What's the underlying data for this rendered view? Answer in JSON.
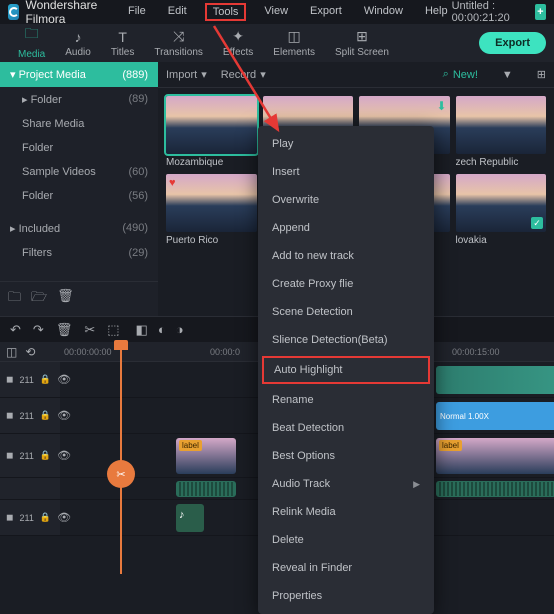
{
  "app": {
    "name": "Wondershare Filmora",
    "doc_title": "Untitled : 00:00:21:20"
  },
  "menu": {
    "file": "File",
    "edit": "Edit",
    "tools": "Tools",
    "view": "View",
    "export": "Export",
    "window": "Window",
    "help": "Help"
  },
  "tabs": {
    "media": "Media",
    "audio": "Audio",
    "titles": "Titles",
    "transitions": "Transitions",
    "effects": "Effects",
    "elements": "Elements",
    "split": "Split Screen"
  },
  "export_button": "Export",
  "sidebar": {
    "header": {
      "label": "Project Media",
      "count": "(889)"
    },
    "items": [
      {
        "label": "▸ Folder",
        "count": "(89)"
      },
      {
        "label": "Share Media",
        "count": ""
      },
      {
        "label": "Folder",
        "count": ""
      },
      {
        "label": "Sample Videos",
        "count": "(60)"
      },
      {
        "label": "Folder",
        "count": "(56)"
      }
    ],
    "included": {
      "label": "Included",
      "count": "(490)"
    },
    "filters": {
      "label": "Filters",
      "count": "(29)"
    }
  },
  "media_bar": {
    "import": "Import",
    "record": "Record",
    "search": "New!"
  },
  "thumbs": [
    {
      "caption": "Mozambique",
      "selected": true
    },
    {
      "caption": ""
    },
    {
      "caption": "",
      "download": true
    },
    {
      "caption": "zech Republic"
    },
    {
      "caption": "Puerto Rico",
      "heart": true
    },
    {
      "caption": ""
    },
    {
      "caption": ""
    },
    {
      "caption": "lovakia",
      "check": true
    }
  ],
  "context": {
    "play": "Play",
    "insert": "Insert",
    "overwrite": "Overwrite",
    "append": "Append",
    "newtrack": "Add to new track",
    "proxy": "Create Proxy flie",
    "scene": "Scene Detection",
    "silence": "Slience Detection(Beta)",
    "autohl": "Auto Highlight",
    "rename": "Rename",
    "beat": "Beat Detection",
    "bestopt": "Best Options",
    "audiotrack": "Audio Track",
    "relink": "Relink Media",
    "delete": "Delete",
    "reveal": "Reveal in Finder",
    "props": "Properties"
  },
  "ruler": {
    "t0": "00:00:00:00",
    "t5": "00:00:0",
    "t15": "00:00:15:00"
  },
  "track_label": "211",
  "clip_labels": {
    "normal": "Normal 1.00X",
    "label": "label"
  }
}
